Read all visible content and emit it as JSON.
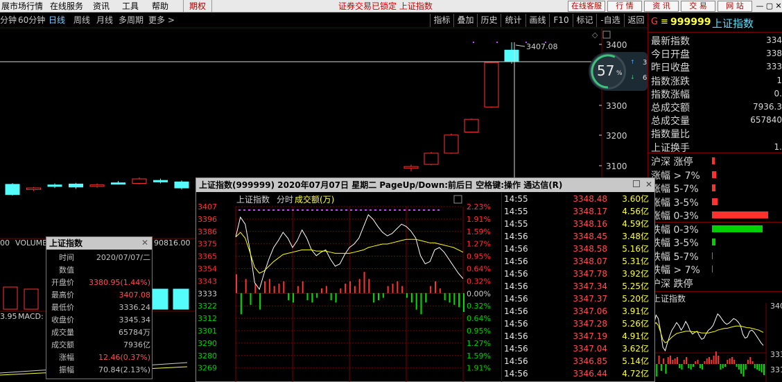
{
  "menubar": {
    "items": [
      "展市场行情",
      "在线服务",
      "资讯",
      "工具",
      "帮助"
    ],
    "rights_label": "期权",
    "status": "证券交易已锁定 上证指数",
    "buttons": [
      "在线客服",
      "行 情",
      "资 讯",
      "交 易",
      "网 站"
    ],
    "window_controls": [
      "—",
      "▢",
      "✕"
    ]
  },
  "toolbar": {
    "periods": [
      "分钟",
      "60分钟",
      "日线",
      "周线",
      "月线",
      "多周期",
      "更多 >"
    ],
    "active_period": "日线",
    "right_tools": [
      "指标",
      "叠加",
      "历史",
      "统计",
      "画线",
      "F10",
      "标记",
      "-自选",
      "返回"
    ]
  },
  "kline": {
    "high_label": "3407.08",
    "price_axis": [
      "3400",
      "3300",
      "3200",
      "3100",
      "3000"
    ],
    "volume_label": "VOLUME",
    "volume_left_value": "00",
    "volume_right_value": "90816.00",
    "macd_label": "MACD:",
    "macd_left_value": "3.95",
    "candles": [
      {
        "o": 2937,
        "c": 2903,
        "h": 2941,
        "l": 2900
      },
      {
        "o": 2920,
        "c": 2925,
        "h": 2928,
        "l": 2915
      },
      {
        "o": 2935,
        "c": 2930,
        "h": 2940,
        "l": 2925
      },
      {
        "o": 2938,
        "c": 2928,
        "h": 2942,
        "l": 2922
      },
      {
        "o": 2930,
        "c": 2935,
        "h": 2940,
        "l": 2926
      },
      {
        "o": 2942,
        "c": 2940,
        "h": 2948,
        "l": 2936
      },
      {
        "o": 2940,
        "c": 2955,
        "h": 2960,
        "l": 2937
      },
      {
        "o": 2950,
        "c": 2945,
        "h": 2956,
        "l": 2940
      },
      {
        "o": 2945,
        "c": 2925,
        "h": 2950,
        "l": 2920
      }
    ],
    "candles_right": [
      {
        "o": 2990,
        "c": 2996,
        "h": 3002,
        "l": 2980
      },
      {
        "o": 3003,
        "c": 3040,
        "h": 3044,
        "l": 3000
      },
      {
        "o": 3040,
        "c": 3100,
        "h": 3105,
        "l": 3038
      },
      {
        "o": 3110,
        "c": 3152,
        "h": 3155,
        "l": 3108
      },
      {
        "o": 3193,
        "c": 3340,
        "h": 3342,
        "l": 3190
      },
      {
        "o": 3381,
        "c": 3345,
        "h": 3407,
        "l": 3336
      }
    ]
  },
  "speed_widget": {
    "percent": "57",
    "percent_sign": "%",
    "up_speed": "3.2",
    "up_unit": "K/s",
    "down_speed": "6",
    "down_unit": "K/s"
  },
  "right_panel": {
    "code_prefix": "G",
    "code_sep": "≡",
    "code": "999999",
    "name": "上证指数",
    "stats": [
      {
        "label": "最新指数",
        "value": "334"
      },
      {
        "label": "今日开盘",
        "value": "338"
      },
      {
        "label": "昨日收盘",
        "value": "333"
      },
      {
        "label": "指数涨跌",
        "value": "1"
      },
      {
        "label": "指数涨幅",
        "value": "0."
      },
      {
        "label": "总成交额",
        "value": "7936.3"
      },
      {
        "label": "总成交量",
        "value": "657840"
      },
      {
        "label": "指数量比",
        "value": ""
      },
      {
        "label": "上证换手",
        "value": "1."
      }
    ],
    "dist": [
      {
        "label": "沪深 涨停",
        "w": 0.04
      },
      {
        "label": "涨幅 > 7%",
        "w": 0.07
      },
      {
        "label": "涨幅 5-7%",
        "w": 0.05
      },
      {
        "label": "涨幅 3-5%",
        "w": 0.09
      },
      {
        "label": "涨幅 0-3%",
        "w": 0.9
      },
      {
        "label": "跌幅 0-3%",
        "w": 0.81
      },
      {
        "label": "跌幅 3-5%",
        "w": 0.05
      },
      {
        "label": "跌幅 5-7%",
        "w": 0.01
      },
      {
        "label": "跌幅 > 7%",
        "w": 0.01
      },
      {
        "label": "沪深 跌停",
        "w": 0.0
      }
    ],
    "mini_title": "上证指数",
    "mini_axis": [
      "340",
      "333",
      "331"
    ]
  },
  "info_panel": {
    "title": "上证指数",
    "close": "✕",
    "rows": [
      {
        "label": "时间",
        "value": "2020/07/07/二"
      },
      {
        "label": "数值",
        "value": ""
      },
      {
        "label": "开盘价",
        "value": "3380.95(1.44%)"
      },
      {
        "label": "最高价",
        "value": "3407.08"
      },
      {
        "label": "最低价",
        "value": "3336.24"
      },
      {
        "label": "收盘价",
        "value": "3345.34"
      },
      {
        "label": "成交量",
        "value": "65784万"
      },
      {
        "label": "成交额",
        "value": "7936亿"
      },
      {
        "label": "涨幅",
        "value": "12.46(0.37%)"
      },
      {
        "label": "振幅",
        "value": "70.84(2.13%)"
      }
    ]
  },
  "intraday": {
    "title": "上证指数(999999) 2020年07月07日 星期二 PageUp/Down:前后日 空格键:操作 通达信(R)",
    "name": "上证指数",
    "mode": "分时",
    "amount_label": "成交额(万)",
    "left_axis": [
      "3407",
      "3396",
      "3386",
      "3375",
      "3365",
      "3354",
      "3343",
      "3333",
      "3322",
      "3312",
      "3301",
      "3290",
      "3280",
      "3269"
    ],
    "right_axis": [
      "2.23%",
      "1.91%",
      "1.59%",
      "1.27%",
      "0.95%",
      "0.64%",
      "0.32%",
      "0.00%",
      "0.32%",
      "0.64%",
      "0.95%",
      "1.27%",
      "1.59%",
      "1.91%"
    ],
    "prev_close": 3333,
    "price": [
      3380.95,
      3398,
      3392,
      3370,
      3342,
      3336.24,
      3350,
      3362,
      3372,
      3378,
      3385,
      3380,
      3372,
      3378,
      3387,
      3380,
      3370,
      3365,
      3368,
      3370,
      3362,
      3356,
      3358,
      3366,
      3372,
      3375,
      3380,
      3390,
      3400,
      3396,
      3390,
      3385,
      3382,
      3384,
      3388,
      3392,
      3390,
      3386,
      3380,
      3365,
      3358,
      3360,
      3370,
      3372,
      3368,
      3362,
      3356,
      3350,
      3345.34
    ],
    "avg": [
      3380.95,
      3385,
      3380,
      3368,
      3355,
      3350,
      3352,
      3356,
      3360,
      3363,
      3366,
      3367,
      3368,
      3369,
      3370,
      3370,
      3370,
      3369,
      3369,
      3369,
      3368,
      3367,
      3367,
      3367,
      3367,
      3368,
      3369,
      3370,
      3372,
      3373,
      3374,
      3375,
      3375,
      3376,
      3377,
      3378,
      3379,
      3379,
      3379,
      3378,
      3377,
      3376,
      3376,
      3375,
      3374,
      3373,
      3372,
      3370,
      3368
    ],
    "amount": [
      0.8,
      -0.9,
      0.6,
      -0.5,
      0.4,
      -0.7,
      0.5,
      0.6,
      0.3,
      0.4,
      0.5,
      -0.3,
      -0.4,
      0.3,
      0.5,
      -0.3,
      -0.4,
      -0.2,
      0.2,
      0.3,
      -0.3,
      -0.4,
      0.2,
      0.4,
      0.5,
      0.3,
      0.6,
      0.9,
      0.6,
      -0.4,
      -0.3,
      -0.2,
      0.3,
      0.4,
      0.5,
      0.3,
      -0.2,
      -0.4,
      -0.7,
      -0.9,
      -0.4,
      0.3,
      0.5,
      0.2,
      -0.3,
      -0.4,
      -0.5,
      -0.6,
      -0.8
    ]
  },
  "ticks": [
    {
      "time": "14:55",
      "price": "3348.48",
      "amt": "3.60亿"
    },
    {
      "time": "14:55",
      "price": "3348.17",
      "amt": "4.56亿"
    },
    {
      "time": "14:55",
      "price": "3348.16",
      "amt": "4.59亿"
    },
    {
      "time": "14:56",
      "price": "3348.45",
      "amt": "3.48亿"
    },
    {
      "time": "14:56",
      "price": "3348.58",
      "amt": "5.16亿"
    },
    {
      "time": "14:56",
      "price": "3348.07",
      "amt": "5.31亿"
    },
    {
      "time": "14:56",
      "price": "3347.78",
      "amt": "3.92亿"
    },
    {
      "time": "14:56",
      "price": "3347.34",
      "amt": "5.25亿"
    },
    {
      "time": "14:56",
      "price": "3347.37",
      "amt": "5.20亿"
    },
    {
      "time": "14:56",
      "price": "3347.06",
      "amt": "3.91亿"
    },
    {
      "time": "14:56",
      "price": "3347.28",
      "amt": "5.26亿"
    },
    {
      "time": "14:56",
      "price": "3347.19",
      "amt": "4.91亿"
    },
    {
      "time": "14:56",
      "price": "3347.04",
      "amt": "3.62亿"
    },
    {
      "time": "14:56",
      "price": "3346.85",
      "amt": "5.14亿"
    },
    {
      "time": "14:56",
      "price": "3346.44",
      "amt": "4.72亿"
    }
  ],
  "colors": {
    "up": "#ff3232",
    "down": "#54fcfc",
    "price_line": "#ffffff",
    "avg_line": "#ffff00",
    "grid": "#7a0000",
    "buy": "#ff3232",
    "sell": "#00e000"
  }
}
